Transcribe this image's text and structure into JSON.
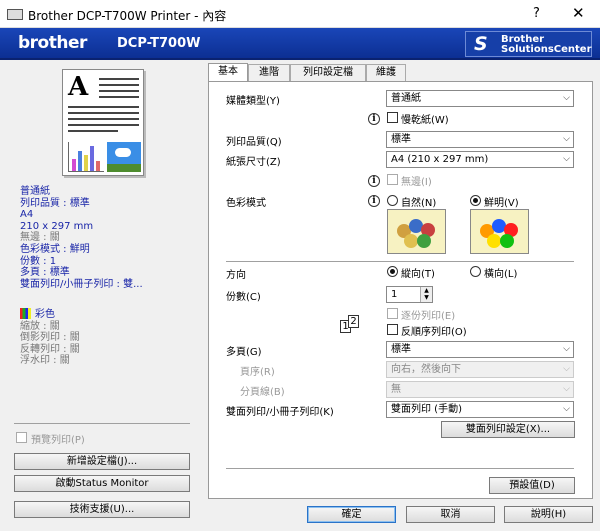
{
  "window": {
    "title": "Brother DCP-T700W Printer - 內容",
    "help": "?",
    "close": "✕"
  },
  "banner": {
    "brand": "brother",
    "model": "DCP-T700W",
    "solutions_icon": "S",
    "solutions_line1": "Brother",
    "solutions_line2": "SolutionsCenter"
  },
  "summary": {
    "lines": [
      {
        "text": "普通紙",
        "style": "blue"
      },
      {
        "text": "列印品質 : 標準",
        "style": "blue"
      },
      {
        "text": "A4",
        "style": "blue"
      },
      {
        "text": "210 x 297 mm",
        "style": "blue"
      },
      {
        "text": "無邊 : 關",
        "style": "gray"
      },
      {
        "text": "色彩模式 : 鮮明",
        "style": "blue"
      },
      {
        "text": "份數 : 1",
        "style": "blue"
      },
      {
        "text": "多頁 : 標準",
        "style": "blue"
      },
      {
        "text": "雙面列印/小冊子列印 : 雙...",
        "style": "blue"
      }
    ],
    "color_header": "彩色",
    "color_lines": [
      "縮放 : 關",
      "倒影列印 : 關",
      "反轉列印 : 關",
      "浮水印 : 關"
    ]
  },
  "left": {
    "preview_print": "預覽列印(P)",
    "add_profile": "新增設定檔(J)...",
    "status_monitor": "啟動Status Monitor",
    "support": "技術支援(U)..."
  },
  "tabs": [
    "基本",
    "進階",
    "列印設定檔",
    "維護"
  ],
  "basic": {
    "media_type_label": "媒體類型(Y)",
    "media_type_value": "普通紙",
    "slow_dry": "慢乾紙(W)",
    "print_quality_label": "列印品質(Q)",
    "print_quality_value": "標準",
    "paper_size_label": "紙張尺寸(Z)",
    "paper_size_value": "A4 (210 x 297 mm)",
    "borderless": "無邊(I)",
    "color_mode_label": "色彩模式",
    "color_natural": "自然(N)",
    "color_vivid": "鮮明(V)",
    "orientation_label": "方向",
    "portrait": "縱向(T)",
    "landscape": "橫向(L)",
    "copies_label": "份數(C)",
    "copies_value": "1",
    "collate": "逐份列印(E)",
    "reverse": "反順序列印(O)",
    "multipage_label": "多頁(G)",
    "multipage_value": "標準",
    "page_order_label": "頁序(R)",
    "page_order_value": "向右，然後向下",
    "border_label": "分頁線(B)",
    "border_value": "無",
    "duplex_label": "雙面列印/小冊子列印(K)",
    "duplex_value": "雙面列印 (手動)",
    "duplex_settings": "雙面列印設定(X)...",
    "default": "預設值(D)"
  },
  "footer": {
    "ok": "確定",
    "cancel": "取消",
    "help": "說明(H)"
  },
  "colors": {
    "banner": "#1a46b8",
    "summary_text": "#1a26a8"
  }
}
